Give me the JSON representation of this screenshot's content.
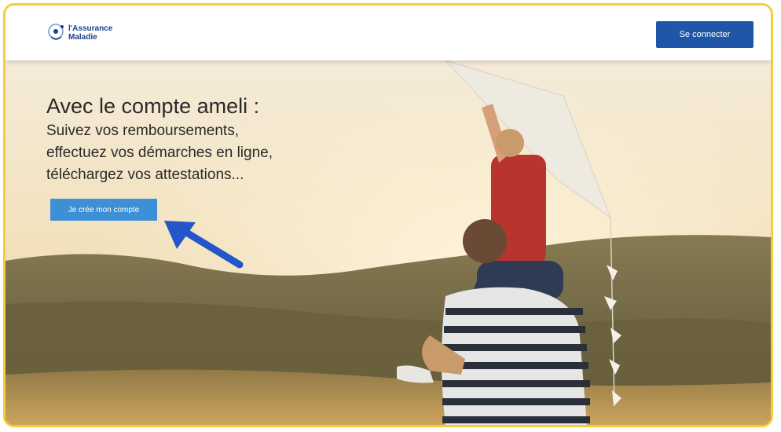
{
  "header": {
    "logo_line1": "l'Assurance",
    "logo_line2": "Maladie",
    "connect_label": "Se connecter"
  },
  "hero": {
    "title": "Avec le compte ameli :",
    "lines": [
      "Suivez vos remboursements,",
      "effectuez vos démarches en ligne,",
      "téléchargez vos attestations..."
    ],
    "cta_label": "Je crée mon compte"
  },
  "colors": {
    "frame_border": "#f2cf3a",
    "primary_button": "#1f56a8",
    "cta_button": "#3d8fd6",
    "annotation_arrow": "#2356c9"
  },
  "icons": {
    "logo": "assurance-maladie-logo",
    "annotation": "pointer-arrow-icon"
  }
}
